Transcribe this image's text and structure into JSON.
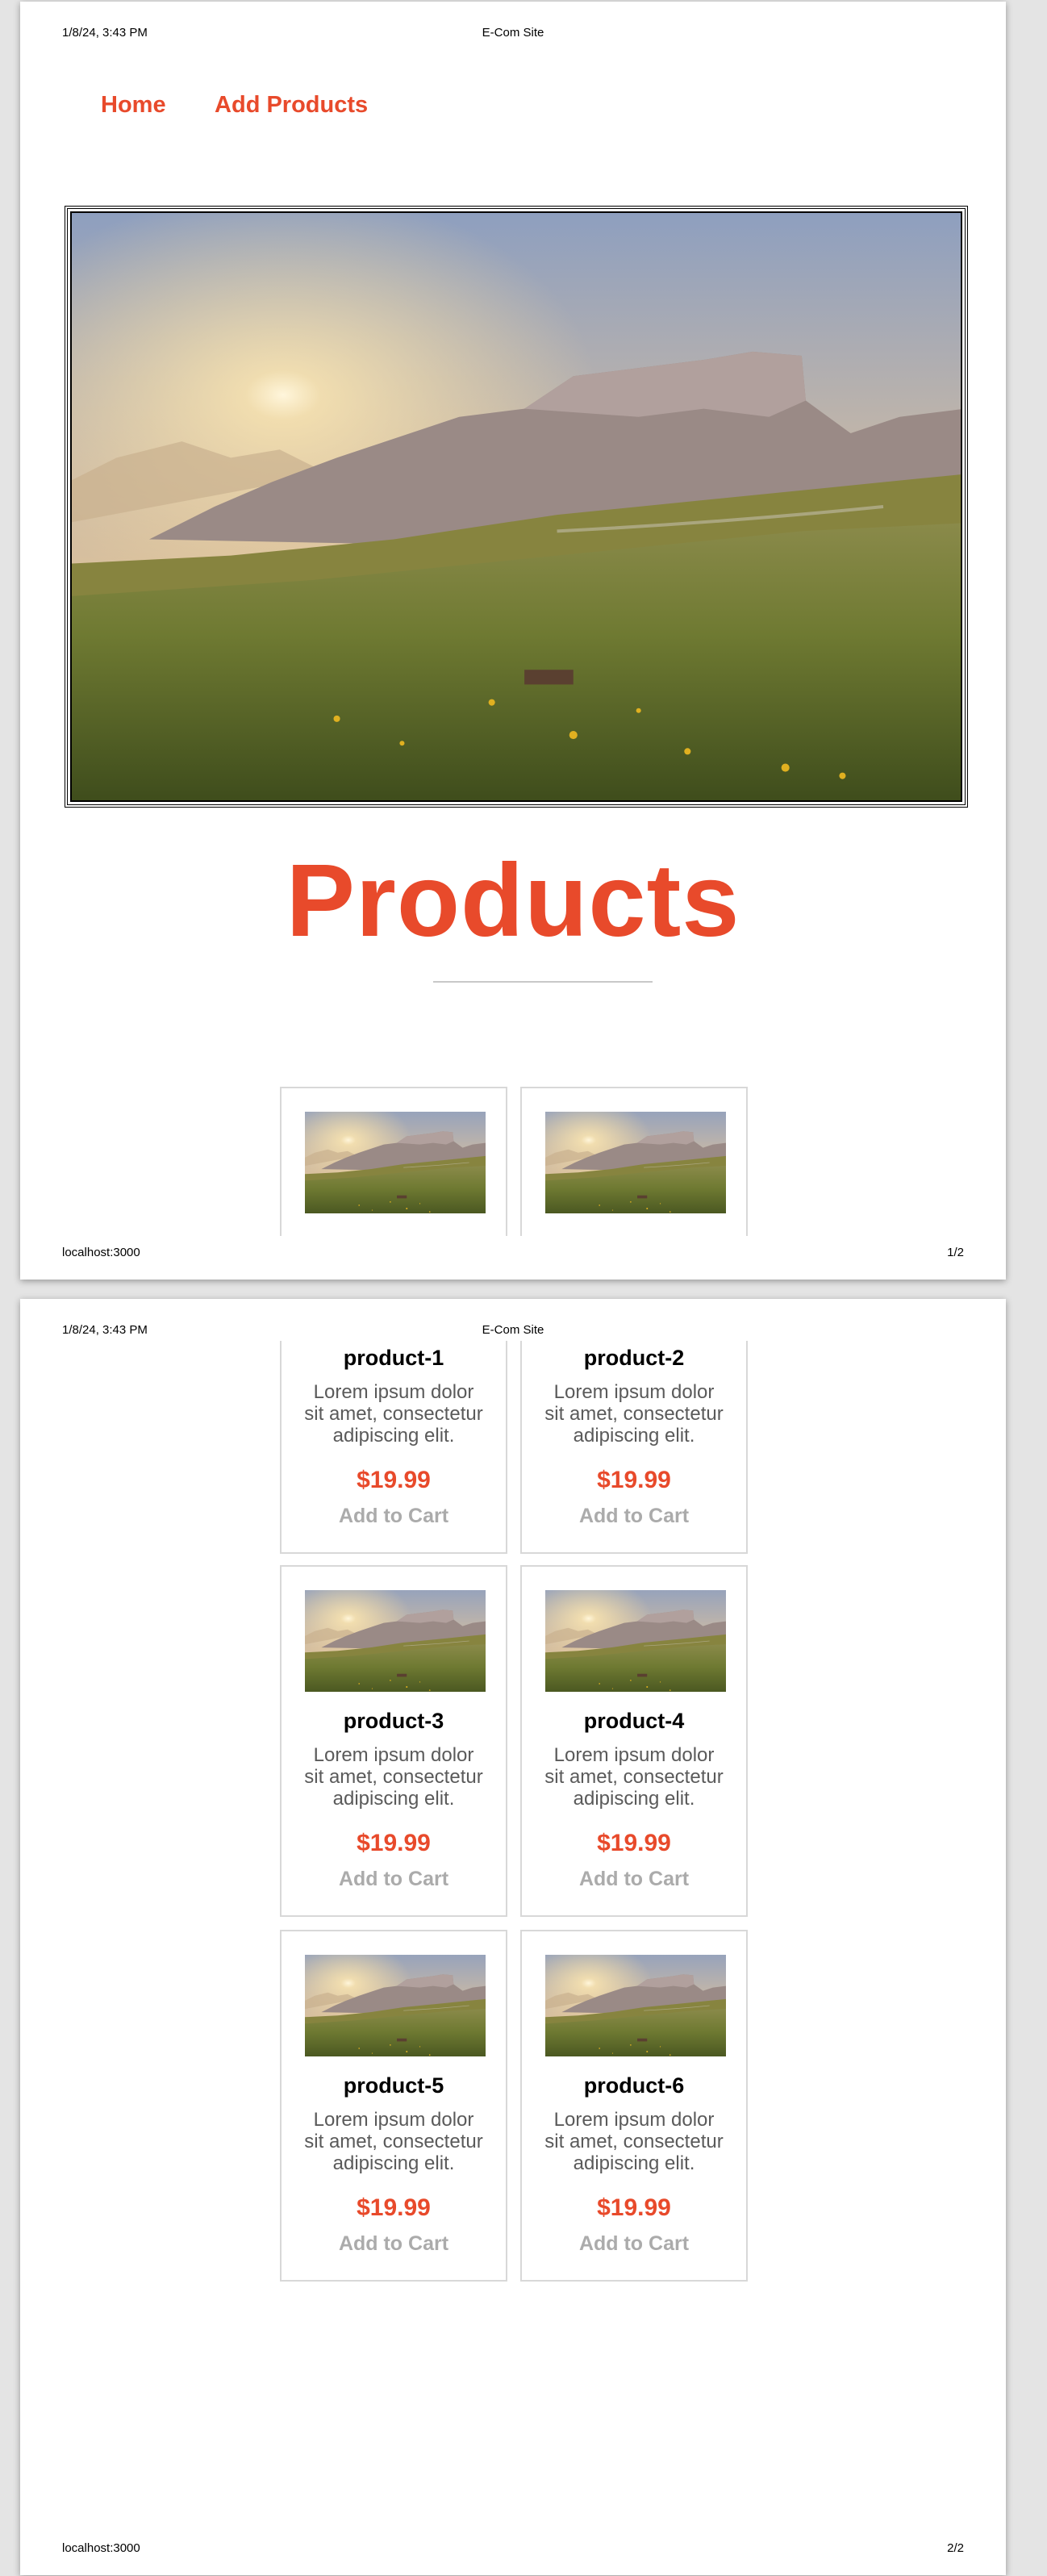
{
  "print_header": {
    "datetime": "1/8/24, 3:43 PM",
    "title": "E-Com Site"
  },
  "print_footer": {
    "url": "localhost:3000",
    "page1": "1/2",
    "page2": "2/2"
  },
  "nav": {
    "items": [
      {
        "label": "Home"
      },
      {
        "label": "Add Products"
      }
    ]
  },
  "main": {
    "heading": "Products"
  },
  "products": [
    {
      "name": "product-1",
      "description": "Lorem ipsum dolor sit amet, consectetur adipiscing elit.",
      "price": "$19.99",
      "cta": "Add to Cart"
    },
    {
      "name": "product-2",
      "description": "Lorem ipsum dolor sit amet, consectetur adipiscing elit.",
      "price": "$19.99",
      "cta": "Add to Cart"
    },
    {
      "name": "product-3",
      "description": "Lorem ipsum dolor sit amet, consectetur adipiscing elit.",
      "price": "$19.99",
      "cta": "Add to Cart"
    },
    {
      "name": "product-4",
      "description": "Lorem ipsum dolor sit amet, consectetur adipiscing elit.",
      "price": "$19.99",
      "cta": "Add to Cart"
    },
    {
      "name": "product-5",
      "description": "Lorem ipsum dolor sit amet, consectetur adipiscing elit.",
      "price": "$19.99",
      "cta": "Add to Cart"
    },
    {
      "name": "product-6",
      "description": "Lorem ipsum dolor sit amet, consectetur adipiscing elit.",
      "price": "$19.99",
      "cta": "Add to Cart"
    }
  ],
  "colors": {
    "accent": "#e84a2b",
    "muted_button": "#ababab",
    "card_border": "#d8d8d8"
  }
}
